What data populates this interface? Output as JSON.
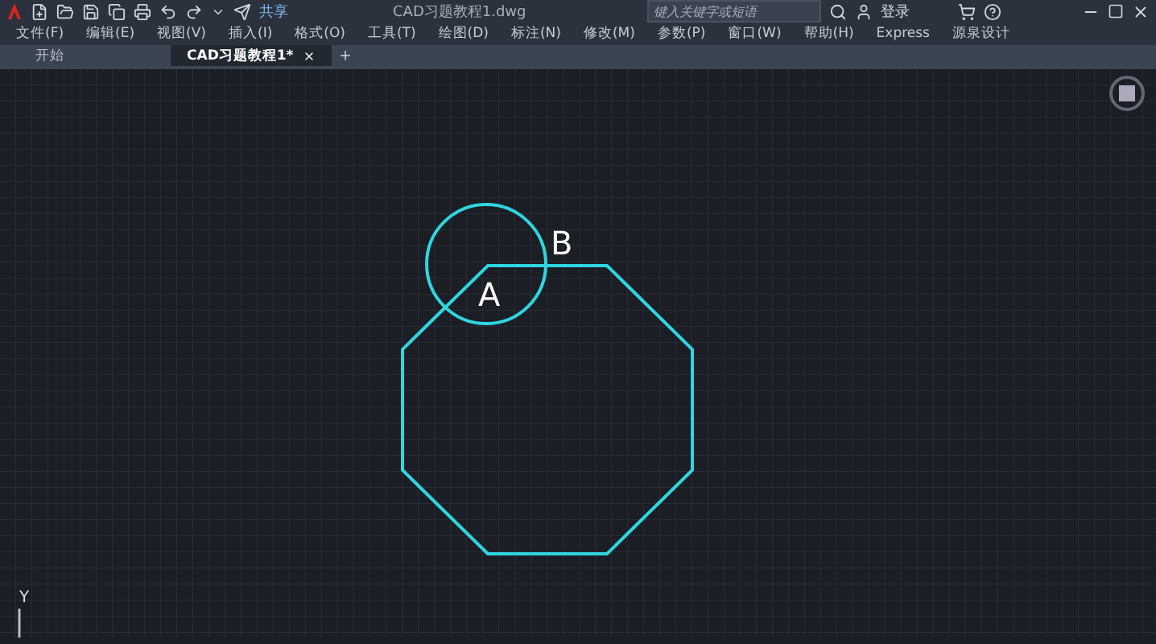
{
  "title_bar": {
    "share": "共享",
    "title": "CAD习题教程1.dwg",
    "search": {
      "placeholder": "键入关键字或短语"
    },
    "login": "登录"
  },
  "menu_bar": [
    "文件(F)",
    "编辑(E)",
    "视图(V)",
    "插入(I)",
    "格式(O)",
    "工具(T)",
    "绘图(D)",
    "标注(N)",
    "修改(M)",
    "参数(P)",
    "窗口(W)",
    "帮助(H)",
    "Express",
    "源泉设计"
  ],
  "tabs": [
    {
      "label": "开始",
      "selected": false
    },
    {
      "label": "CAD习题教程1*",
      "selected": true
    }
  ],
  "canvas": {
    "point_labels": [
      "A",
      "B"
    ],
    "ucs_axis": "Y"
  }
}
